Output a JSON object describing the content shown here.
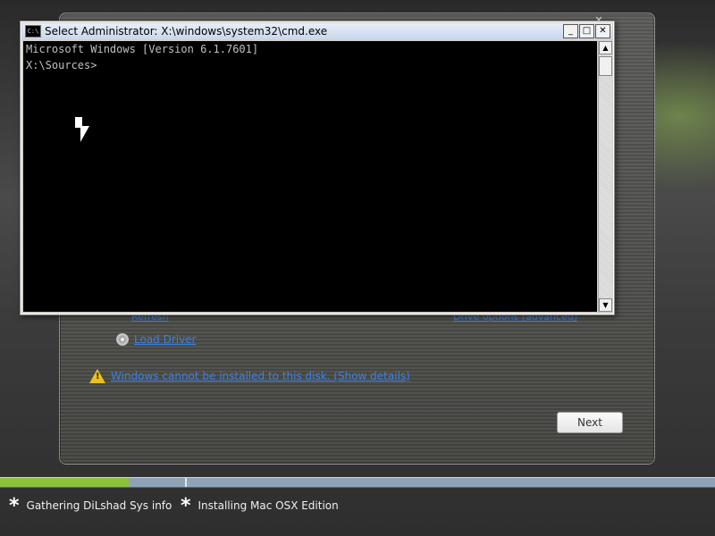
{
  "cmd_window": {
    "title": "Select Administrator: X:\\windows\\system32\\cmd.exe",
    "icon": "C:\\",
    "controls": {
      "minimize": "_",
      "maximize": "□",
      "close": "✕"
    },
    "console_lines": [
      "Microsoft Windows [Version 6.1.7601]",
      "",
      "X:\\Sources>"
    ],
    "scroll_up": "▲",
    "scroll_down": "▼"
  },
  "installer": {
    "close_glyph": "✕",
    "load_driver_label": "Load Driver",
    "warning_text": "Windows cannot be installed to this disk. (Show details)",
    "next_label": "Next",
    "partial_link_left": "Refresh",
    "partial_link_right": "Drive options (advanced)"
  },
  "status_bar": {
    "progress": 0.18,
    "steps": [
      {
        "star": "*",
        "label": "Gathering DiLshad Sys info"
      },
      {
        "star": "*",
        "label": "Installing Mac OSX Edition"
      }
    ]
  },
  "colors": {
    "progress_fill": "#8cc23a",
    "progress_track": "#8fa3b8",
    "link": "#3f7fe0",
    "console_bg": "#000000",
    "console_fg": "#c0c0c0"
  }
}
